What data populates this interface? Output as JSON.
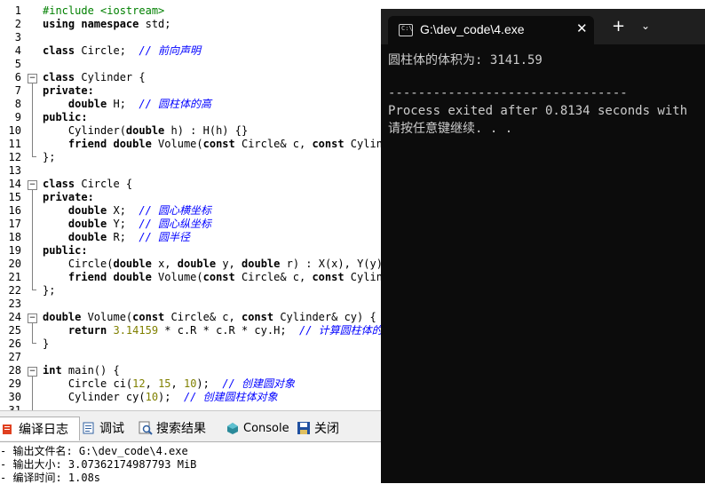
{
  "editor": {
    "line_numbers": [
      "1",
      "2",
      "3",
      "4",
      "5",
      "6",
      "7",
      "8",
      "9",
      "10",
      "11",
      "12",
      "13",
      "14",
      "15",
      "16",
      "17",
      "18",
      "19",
      "20",
      "21",
      "22",
      "23",
      "24",
      "25",
      "26",
      "27",
      "28",
      "29",
      "30",
      "31"
    ]
  },
  "code": {
    "l1": "#include <iostream>",
    "l2a": "using namespace",
    "l2b": " std;",
    "l4a": "class",
    "l4b": " Circle;  ",
    "l4c": "// 前向声明",
    "l6a": "class",
    "l6b": " Cylinder {",
    "l7": "private:",
    "l8a": "    double",
    "l8b": " H;  ",
    "l8c": "// 圆柱体的高",
    "l9": "public:",
    "l10a": "    Cylinder(",
    "l10b": "double",
    "l10c": " h) : H(h) {}",
    "l11a": "    friend double",
    "l11b": " Volume(",
    "l11c": "const",
    "l11d": " Circle& c, ",
    "l11e": "const",
    "l11f": " Cylinder",
    "l12": "};",
    "l14a": "class",
    "l14b": " Circle {",
    "l15": "private:",
    "l16a": "    double",
    "l16b": " X;  ",
    "l16c": "// 圆心横坐标",
    "l17a": "    double",
    "l17b": " Y;  ",
    "l17c": "// 圆心纵坐标",
    "l18a": "    double",
    "l18b": " R;  ",
    "l18c": "// 圆半径",
    "l19": "public:",
    "l20a": "    Circle(",
    "l20b": "double",
    "l20c": " x, ",
    "l20d": "double",
    "l20e": " y, ",
    "l20f": "double",
    "l20g": " r) : X(x), Y(y),",
    "l21a": "    friend double",
    "l21b": " Volume(",
    "l21c": "const",
    "l21d": " Circle& c, ",
    "l21e": "const",
    "l21f": " Cylinde",
    "l22": "};",
    "l24a": "double",
    "l24b": " Volume(",
    "l24c": "const",
    "l24d": " Circle& c, ",
    "l24e": "const",
    "l24f": " Cylinder& cy) {",
    "l25a": "    return",
    "l25b": " 3.14159",
    "l25c": " * c.R * c.R * cy.H;  ",
    "l25d": "// 计算圆柱体的",
    "l26": "}",
    "l28a": "int",
    "l28b": " main() {",
    "l29a": "    Circle ci(",
    "l29b": "12",
    "l29c": ", ",
    "l29d": "15",
    "l29e": ", ",
    "l29f": "10",
    "l29g": ");  ",
    "l29h": "// 创建圆对象",
    "l30a": "    Cylinder cy(",
    "l30b": "10",
    "l30c": ");  ",
    "l30d": "// 创建圆柱体对象"
  },
  "panel": {
    "tabs": [
      {
        "label": "编译日志"
      },
      {
        "label": "调试"
      },
      {
        "label": "搜索结果"
      },
      {
        "label": "Console"
      },
      {
        "label": "关闭"
      }
    ],
    "log": [
      "- 输出文件名: G:\\dev_code\\4.exe",
      "- 输出大小: 3.07362174987793 MiB",
      "- 编译时间: 1.08s"
    ]
  },
  "console": {
    "tab_title": "G:\\dev_code\\4.exe",
    "icon_text": "C:\\",
    "lines": [
      "圆柱体的体积为: 3141.59",
      "",
      "--------------------------------",
      "Process exited after 0.8134 seconds with",
      "请按任意键继续. . ."
    ]
  },
  "colors": {
    "console_bg": "#0c0c0c",
    "titlebar_bg": "#1f1f1f",
    "comment": "#0000ff",
    "preprocessor": "#008000",
    "number": "#808000"
  }
}
